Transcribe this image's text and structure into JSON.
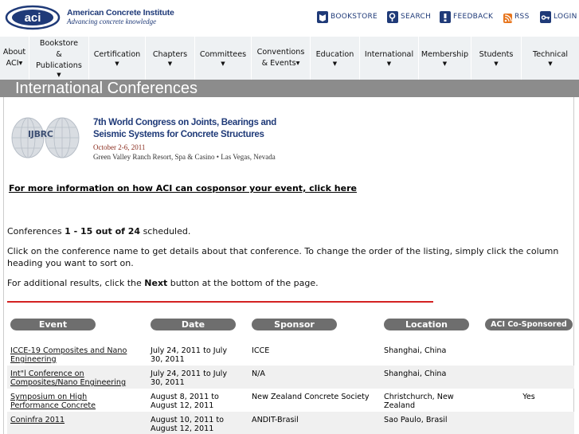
{
  "header": {
    "org_name": "American Concrete Institute",
    "tagline": "Advancing concrete knowledge",
    "logo_text": "aci",
    "utility_links": [
      {
        "label": "BOOKSTORE",
        "icon": "book-icon"
      },
      {
        "label": "SEARCH",
        "icon": "search-icon"
      },
      {
        "label": "FEEDBACK",
        "icon": "feedback-icon"
      },
      {
        "label": "RSS",
        "icon": "rss-icon"
      },
      {
        "label": "LOGIN",
        "icon": "key-icon"
      }
    ]
  },
  "nav": {
    "items": [
      {
        "line1": "About",
        "line2": "ACI▾",
        "line3": ""
      },
      {
        "line1": "Bookstore",
        "line2": "&",
        "line3": "Publications"
      },
      {
        "line1": "Certification",
        "line2": "",
        "line3": ""
      },
      {
        "line1": "Chapters",
        "line2": "",
        "line3": ""
      },
      {
        "line1": "Committees",
        "line2": "",
        "line3": ""
      },
      {
        "line1": "Conventions",
        "line2": "& Events▾",
        "line3": ""
      },
      {
        "line1": "Education",
        "line2": "",
        "line3": ""
      },
      {
        "line1": "International",
        "line2": "",
        "line3": ""
      },
      {
        "line1": "Membership",
        "line2": "",
        "line3": ""
      },
      {
        "line1": "Students",
        "line2": "",
        "line3": ""
      },
      {
        "line1": "Technical",
        "line2": "",
        "line3": ""
      }
    ]
  },
  "page_title": "International Conferences",
  "banner": {
    "abbr": "IJBRC",
    "line1": "7th World Congress on Joints, Bearings and",
    "line2": "Seismic Systems for Concrete Structures",
    "dates": "October 2-6, 2011",
    "venue": "Green Valley Ranch Resort, Spa & Casino • Las Vegas, Nevada"
  },
  "cosponsor_link": "For more information on how ACI can cosponsor your event, click here",
  "count": {
    "prefix": "Conferences ",
    "range": "1 - 15 out of 24",
    "suffix": " scheduled."
  },
  "instructions": "Click on the conference name to get details about that conference. To change the order of the listing, simply click the column heading you want to sort on.",
  "more": {
    "prefix": "For additional results, click the ",
    "next": "Next",
    "suffix": " button at the bottom of the page."
  },
  "table": {
    "headers": {
      "event": "Event",
      "date": "Date",
      "sponsor": "Sponsor",
      "location": "Location",
      "aci": "ACI Co-Sponsored"
    },
    "rows": [
      {
        "event": "ICCE-19 Composites and Nano Engineering",
        "date": "July 24, 2011 to July 30, 2011",
        "sponsor": "ICCE",
        "location": "Shanghai, China",
        "aci": ""
      },
      {
        "event": "Int\"l Conference on Composites/Nano Engineering",
        "date": "July 24, 2011 to July 30, 2011",
        "sponsor": "N/A",
        "location": "Shanghai, China",
        "aci": ""
      },
      {
        "event": "Symposium on High Performance Concrete",
        "date": "August 8, 2011 to August 12, 2011",
        "sponsor": "New Zealand Concrete Society",
        "location": "Christchurch, New Zealand",
        "aci": "Yes"
      },
      {
        "event": "Coninfra 2011",
        "date": "August 10, 2011 to August 12, 2011",
        "sponsor": "ANDIT-Brasil",
        "location": "Sao Paulo, Brasil",
        "aci": ""
      }
    ]
  },
  "colors": {
    "brand_blue": "#1f3a78",
    "title_bar": "#8c8c8c",
    "header_pill": "#6e6e6e",
    "rule_red": "#d42222",
    "nav_bg": "#eef1f3"
  }
}
